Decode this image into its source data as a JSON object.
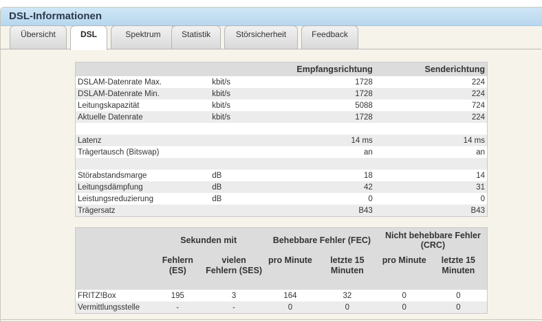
{
  "header": {
    "title": "DSL-Informationen"
  },
  "tabs": [
    {
      "label": "Übersicht"
    },
    {
      "label": "DSL"
    },
    {
      "label": "Spektrum"
    },
    {
      "label": "Statistik"
    },
    {
      "label": "Störsicherheit"
    },
    {
      "label": "Feedback"
    }
  ],
  "line_table": {
    "headers": {
      "label": "",
      "unit": "",
      "down": "Empfangsrichtung",
      "up": "Senderichtung"
    },
    "rows": [
      {
        "label": "DSLAM-Datenrate Max.",
        "unit": "kbit/s",
        "down": "1728",
        "up": "224"
      },
      {
        "label": "DSLAM-Datenrate Min.",
        "unit": "kbit/s",
        "down": "1728",
        "up": "224"
      },
      {
        "label": "Leitungskapazität",
        "unit": "kbit/s",
        "down": "5088",
        "up": "724"
      },
      {
        "label": "Aktuelle Datenrate",
        "unit": "kbit/s",
        "down": "1728",
        "up": "224"
      },
      {
        "label": "",
        "unit": "",
        "down": "",
        "up": ""
      },
      {
        "label": "Latenz",
        "unit": "",
        "down": "14 ms",
        "up": "14 ms"
      },
      {
        "label": "Trägertausch (Bitswap)",
        "unit": "",
        "down": "an",
        "up": "an"
      },
      {
        "label": "",
        "unit": "",
        "down": "",
        "up": ""
      },
      {
        "label": "Störabstandsmarge",
        "unit": "dB",
        "down": "18",
        "up": "14"
      },
      {
        "label": "Leitungsdämpfung",
        "unit": "dB",
        "down": "42",
        "up": "31"
      },
      {
        "label": "Leistungsreduzierung",
        "unit": "dB",
        "down": "0",
        "up": "0"
      },
      {
        "label": "Trägersatz",
        "unit": "",
        "down": "B43",
        "up": "B43"
      }
    ]
  },
  "error_table": {
    "groups": {
      "seconds": "Sekunden mit",
      "fec": "Behebbare Fehler (FEC)",
      "crc": "Nicht behebbare Fehler (CRC)"
    },
    "subheaders": {
      "es": "Fehlern (ES)",
      "ses": "vielen Fehlern (SES)",
      "fec_pro": "pro Minute",
      "fec_15": "letzte 15 Minuten",
      "crc_pro": "pro Minute",
      "crc_15": "letzte 15 Minuten"
    },
    "rows": [
      {
        "label": "FRITZ!Box",
        "es": "195",
        "ses": "3",
        "fec_pro": "164",
        "fec_15": "32",
        "crc_pro": "0",
        "crc_15": "0"
      },
      {
        "label": "Vermittlungsstelle",
        "es": "-",
        "ses": "-",
        "fec_pro": "0",
        "fec_15": "0",
        "crc_pro": "0",
        "crc_15": "0"
      }
    ]
  }
}
